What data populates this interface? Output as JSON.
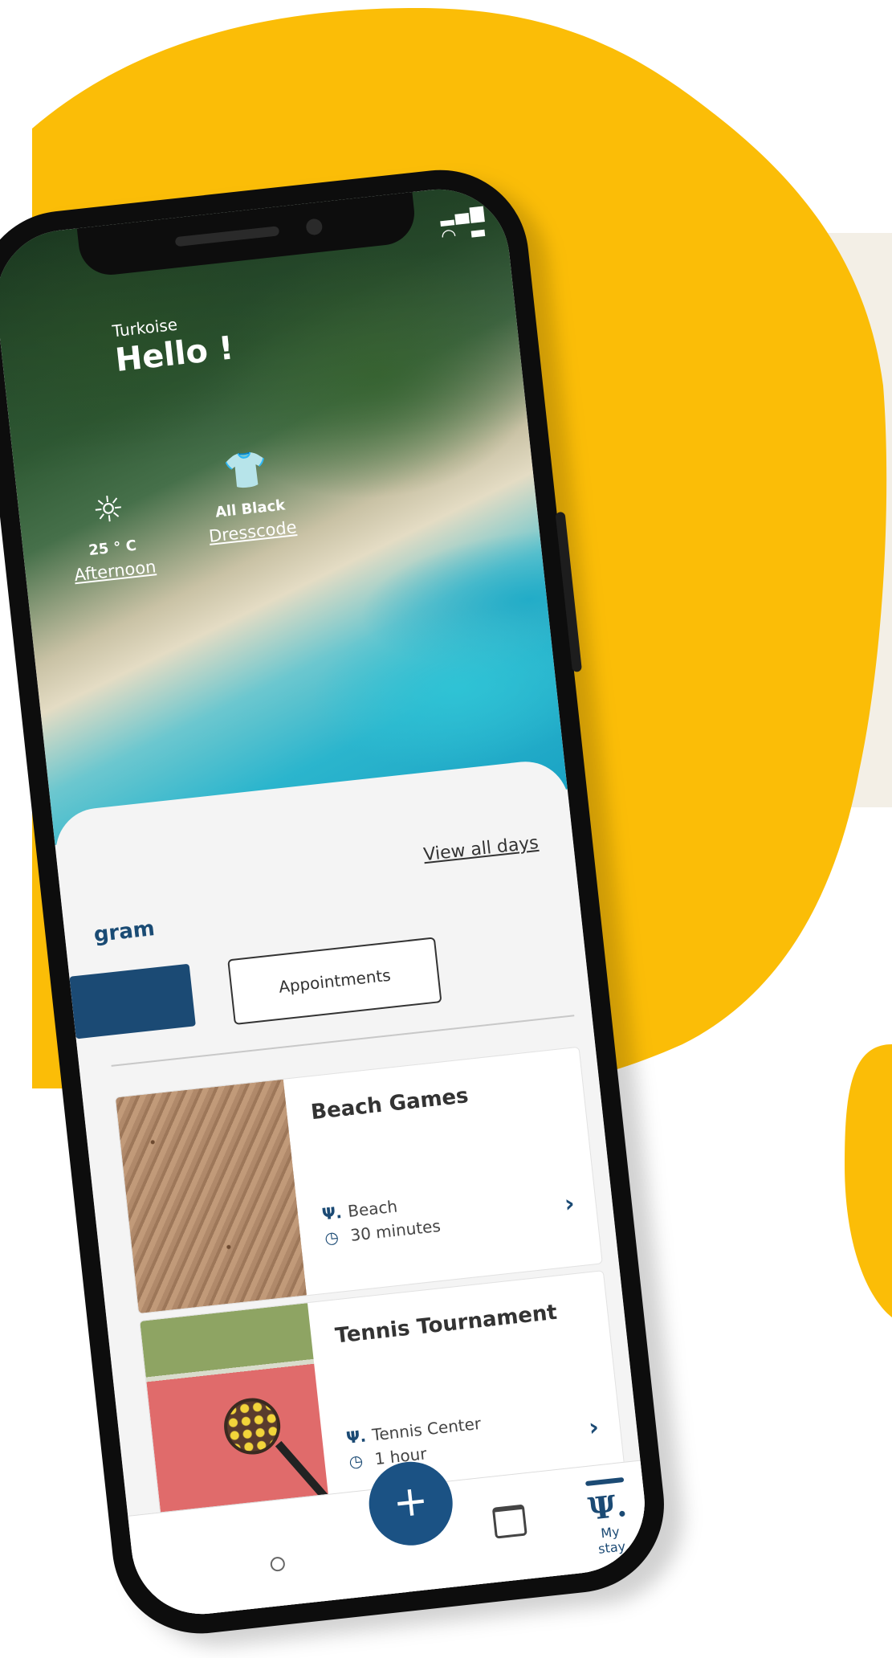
{
  "colors": {
    "blob": "#fbbd07",
    "panel": "#f3efe6",
    "accent": "#1b4a74",
    "fab": "#1b5284"
  },
  "status": {
    "signal": "signal-icon",
    "wifi": "wifi-icon",
    "battery": "battery-icon"
  },
  "header": {
    "resort": "Turkoise",
    "greeting": "Hello !"
  },
  "weather": {
    "icon": "sun-icon",
    "value": "25 ° C",
    "label": "Afternoon"
  },
  "dresscode": {
    "icon": "shirt-icon",
    "value": "All Black",
    "label": "Dresscode"
  },
  "program": {
    "view_all": "View all days",
    "title": "gram",
    "tabs": {
      "appointments": "Appointments"
    }
  },
  "activities": [
    {
      "title": "Beach Games",
      "location": "Beach",
      "duration": "30 minutes"
    },
    {
      "title": "Tennis Tournament",
      "location": "Tennis Center",
      "duration": "1 hour"
    }
  ],
  "nav": {
    "home": "home-icon",
    "add": "+",
    "calendar": "calendar-icon",
    "my_stay_icon": "Ψ.",
    "my_stay": "My stay"
  }
}
